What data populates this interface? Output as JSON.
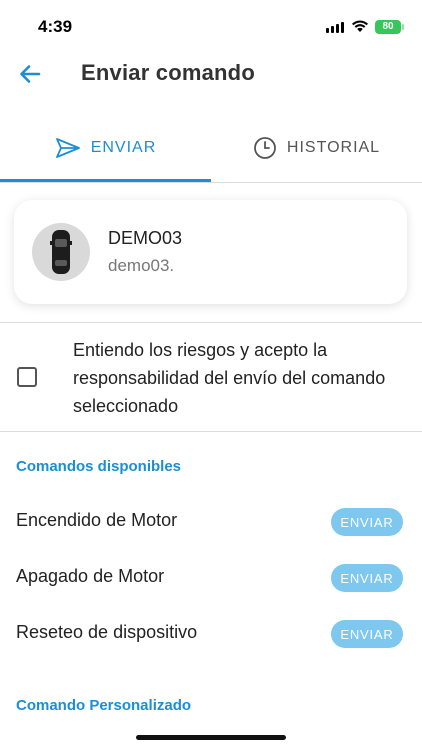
{
  "status_bar": {
    "time": "4:39",
    "battery": "80"
  },
  "header": {
    "title": "Enviar comando"
  },
  "tabs": [
    {
      "label": "ENVIAR",
      "active": true
    },
    {
      "label": "HISTORIAL",
      "active": false
    }
  ],
  "device": {
    "name": "DEMO03",
    "subtitle": "demo03."
  },
  "consent": {
    "text": "Entiendo los riesgos y acepto la responsabilidad del envío del comando seleccionado",
    "checked": false
  },
  "sections": {
    "available": "Comandos disponibles",
    "custom": "Comando Personalizado"
  },
  "commands": [
    {
      "label": "Encendido de Motor",
      "button": "ENVIAR"
    },
    {
      "label": "Apagado de Motor",
      "button": "ENVIAR"
    },
    {
      "label": "Reseteo de dispositivo",
      "button": "ENVIAR"
    }
  ],
  "colors": {
    "accent": "#1a8fd6",
    "button_disabled": "#7ec8f0",
    "battery": "#35c759"
  }
}
